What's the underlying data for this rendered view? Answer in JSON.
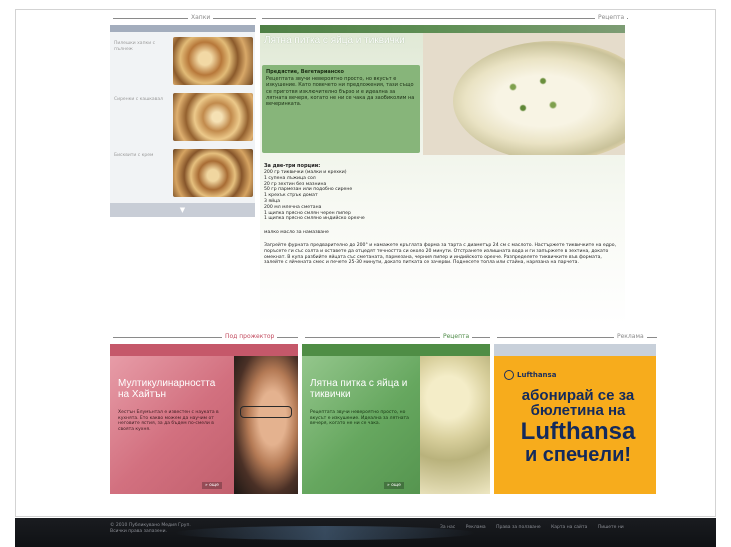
{
  "sections": {
    "left_label": "Хапки",
    "main_label": "Рецепта",
    "promo1_label": "Под прожектор",
    "promo2_label": "Рецепта",
    "promo3_label": "Реклама"
  },
  "sidebar": {
    "items": [
      {
        "label": "Пилешки хапки с пълнеж"
      },
      {
        "label": "Сиренки с кашкавал"
      },
      {
        "label": "Бисквити с крем"
      }
    ],
    "more_label": "▼"
  },
  "article": {
    "title": "Лятна питка с яйца и тиквички",
    "lead_title": "Предястие, Вегетарианско",
    "lead_text": "Рецептата звучи невероятно просто, но вкусът е изкушение. Като повечето ни предложения, тази също се приготвя изключително бързо и е идеална за лятната вечеря, когато не ни се чака да заобиколим на вечеринката.",
    "ingredients_title": "За две-три порции:",
    "ingredients": [
      "200 гр тиквички (малки и крехки)",
      "1 супена лъжица сол",
      "20 гр зехтин без мазнина",
      "50 гр пармезан или подобно сирене",
      "1 крехък стрък домат",
      "3 яйца",
      "200 мл млечна сметана",
      "1 щипка прясно смлян черен пипер",
      "1 щипка прясно смляно индийско орехче"
    ],
    "ingredients_extra": "малко масло за намазване",
    "method": "Загрейте фурната предварително до 200° и намажете кръглата форма за тарта с диаметър 24 см с маслото. Настържете тиквичките на едро, поръсете ги със солта и оставете да отцедят течността си около 20 минути. Отстранете излишната вода и ги запържете в зехтина, докато омекнат. В купа разбийте яйцата със сметаната, пармезана, черния пипер и индийското орехче. Разпределете тиквичките във формата, залейте с яйчената смес и печете 25-30 минути, докато питката се зачерви. Поднесете топла или стайна, нарязана на парчета."
  },
  "promos": [
    {
      "title": "Мултикулинарността на Хайтън",
      "text": "Хестън Блумънтал е известен с науката в кухнята. Ето какво можем да научим от неговите ястия, за да бъдем по-смели в своята кухня.",
      "more": "» още"
    },
    {
      "title": "Лятна питка с яйца и тиквички",
      "text": "Рецептата звучи невероятно просто, но вкусът е изкушение. Идеална за лятната вечеря, когато не ни се чака.",
      "more": "» още"
    }
  ],
  "ad": {
    "brand": "Lufthansa",
    "line1": "абонирай се за",
    "line2": "бюлетина на",
    "line3": "Lufthansa",
    "line4": "и спечели!"
  },
  "footer": {
    "copyright": "© 2010 Публикувано Медия Груп.",
    "rights": "Всички права запазени.",
    "links": [
      "За нас",
      "Реклама",
      "Права за ползване",
      "Карта на сайта",
      "Пишете ни"
    ]
  },
  "colors": {
    "recipe_green": "#87b57a",
    "promo_pink": "#d2707f",
    "ad_orange": "#f7ac1c",
    "footer_dark": "#13151a"
  }
}
